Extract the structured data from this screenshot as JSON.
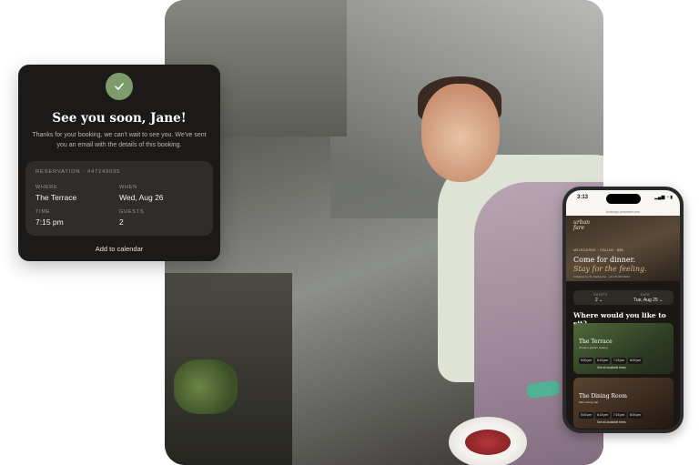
{
  "card": {
    "title": "See you soon, Jane!",
    "message": "Thanks for your booking, we can't wait to see you. We've sent you an email with the details of this booking.",
    "reservation_header": "RESERVATION · #47249035",
    "fields": [
      {
        "label": "WHERE",
        "value": "The Terrace"
      },
      {
        "label": "WHEN",
        "value": "Wed, Aug 26"
      },
      {
        "label": "TIME",
        "value": "7:15 pm"
      },
      {
        "label": "GUESTS",
        "value": "2"
      }
    ],
    "add_calendar": "Add to calendar",
    "accent": "#7d9c6c"
  },
  "phone": {
    "time": "3:13",
    "status_icons": "▂▄▆ ◔ ▮",
    "url": "bookings.urbanfare.com",
    "logo_line1": "urban",
    "logo_line2": "fare",
    "venue_meta": "MELBOURNE · ITALIAN · $$$",
    "headline": "Come for dinner.",
    "headline_italic": "Stay for the feeling.",
    "address": "6 Melbourne St, Melbourne · +61 03 000 0000",
    "guests_label": "GUESTS",
    "guests_value": "2 ⌄",
    "date_label": "DATE",
    "date_value": "Tue, Aug 25 ⌄",
    "question": "Where would you like to sit?",
    "rooms": [
      {
        "name": "The Terrace",
        "sub": "Outdoor garden seating",
        "slots": [
          "5:00 pm",
          "6:15 pm",
          "7:15 pm",
          "8:00 pm"
        ],
        "see_all": "See all available times"
      },
      {
        "name": "The Dining Room",
        "sub": "Main dining hall",
        "slots": [
          "5:00 pm",
          "6:15 pm",
          "7:15 pm",
          "8:00 pm"
        ],
        "see_all": "See all available times"
      }
    ]
  }
}
